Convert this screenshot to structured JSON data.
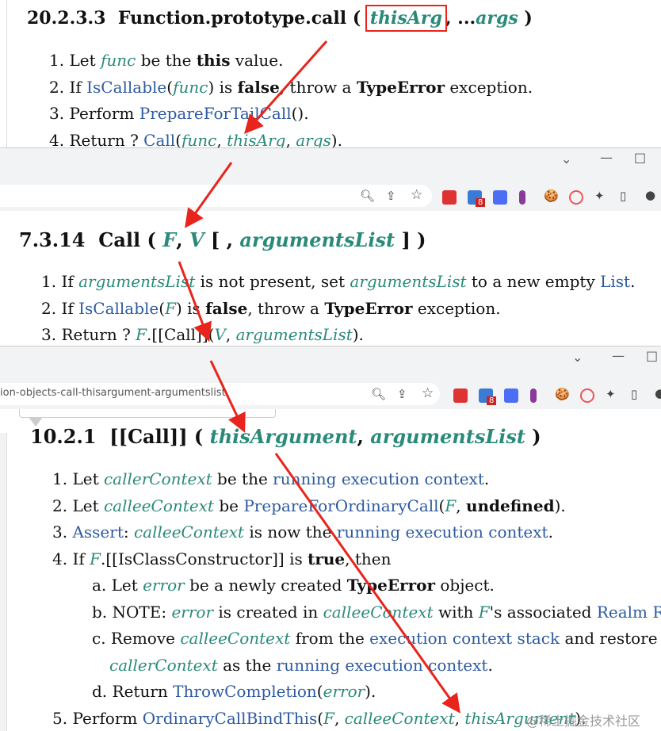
{
  "section1": {
    "number": "20.2.3.3",
    "title": "Function.prototype.call",
    "param1": "thisArg",
    "param2": "args",
    "steps": [
      {
        "n": "1.",
        "parts": [
          [
            "t",
            "Let "
          ],
          [
            "v",
            "func"
          ],
          [
            "t",
            " be the "
          ],
          [
            "b",
            "this"
          ],
          [
            "t",
            " value."
          ]
        ]
      },
      {
        "n": "2.",
        "parts": [
          [
            "t",
            "If "
          ],
          [
            "l",
            "IsCallable"
          ],
          [
            "t",
            "("
          ],
          [
            "v",
            "func"
          ],
          [
            "t",
            ") is "
          ],
          [
            "b",
            "false"
          ],
          [
            "t",
            ", throw a "
          ],
          [
            "b",
            "TypeError"
          ],
          [
            "t",
            " exception."
          ]
        ]
      },
      {
        "n": "3.",
        "parts": [
          [
            "t",
            "Perform "
          ],
          [
            "l",
            "PrepareForTailCall"
          ],
          [
            "t",
            "()."
          ]
        ]
      },
      {
        "n": "4.",
        "parts": [
          [
            "t",
            "Return ? "
          ],
          [
            "l",
            "Call"
          ],
          [
            "t",
            "("
          ],
          [
            "v",
            "func"
          ],
          [
            "t",
            ", "
          ],
          [
            "v",
            "thisArg"
          ],
          [
            "t",
            ", "
          ],
          [
            "v",
            "args"
          ],
          [
            "t",
            ")."
          ]
        ]
      }
    ]
  },
  "section2": {
    "number": "7.3.14",
    "title": "Call",
    "params": [
      "F",
      "V",
      "argumentsList"
    ],
    "steps": [
      {
        "n": "1.",
        "parts": [
          [
            "t",
            "If "
          ],
          [
            "v",
            "argumentsList"
          ],
          [
            "t",
            " is not present, set "
          ],
          [
            "v",
            "argumentsList"
          ],
          [
            "t",
            " to a new empty "
          ],
          [
            "l",
            "List"
          ],
          [
            "t",
            "."
          ]
        ]
      },
      {
        "n": "2.",
        "parts": [
          [
            "t",
            "If "
          ],
          [
            "l",
            "IsCallable"
          ],
          [
            "t",
            "("
          ],
          [
            "v",
            "F"
          ],
          [
            "t",
            ") is "
          ],
          [
            "b",
            "false"
          ],
          [
            "t",
            ", throw a "
          ],
          [
            "b",
            "TypeError"
          ],
          [
            "t",
            " exception."
          ]
        ]
      },
      {
        "n": "3.",
        "parts": [
          [
            "t",
            "Return ? "
          ],
          [
            "v",
            "F"
          ],
          [
            "t",
            ".[[Call]]("
          ],
          [
            "v",
            "V"
          ],
          [
            "t",
            ", "
          ],
          [
            "v",
            "argumentsList"
          ],
          [
            "t",
            ")."
          ]
        ]
      }
    ]
  },
  "section3": {
    "number": "10.2.1",
    "title": "[[Call]]",
    "params": [
      "thisArgument",
      "argumentsList"
    ],
    "steps": [
      {
        "n": "1.",
        "indent": 0,
        "parts": [
          [
            "t",
            "Let "
          ],
          [
            "v",
            "callerContext"
          ],
          [
            "t",
            " be the "
          ],
          [
            "l",
            "running execution context"
          ],
          [
            "t",
            "."
          ]
        ]
      },
      {
        "n": "2.",
        "indent": 0,
        "parts": [
          [
            "t",
            "Let "
          ],
          [
            "v",
            "calleeContext"
          ],
          [
            "t",
            " be "
          ],
          [
            "l",
            "PrepareForOrdinaryCall"
          ],
          [
            "t",
            "("
          ],
          [
            "v",
            "F"
          ],
          [
            "t",
            ", "
          ],
          [
            "b",
            "undefined"
          ],
          [
            "t",
            ")."
          ]
        ]
      },
      {
        "n": "3.",
        "indent": 0,
        "parts": [
          [
            "l",
            "Assert"
          ],
          [
            "t",
            ": "
          ],
          [
            "v",
            "calleeContext"
          ],
          [
            "t",
            " is now the "
          ],
          [
            "l",
            "running execution context"
          ],
          [
            "t",
            "."
          ]
        ]
      },
      {
        "n": "4.",
        "indent": 0,
        "parts": [
          [
            "t",
            "If "
          ],
          [
            "v",
            "F"
          ],
          [
            "t",
            ".[[IsClassConstructor]] is "
          ],
          [
            "b",
            "true"
          ],
          [
            "t",
            ", then"
          ]
        ]
      },
      {
        "n": "a.",
        "indent": 1,
        "parts": [
          [
            "t",
            "Let "
          ],
          [
            "v",
            "error"
          ],
          [
            "t",
            " be a newly created "
          ],
          [
            "b",
            "TypeError"
          ],
          [
            "t",
            " object."
          ]
        ]
      },
      {
        "n": "b.",
        "indent": 1,
        "parts": [
          [
            "t",
            "NOTE: "
          ],
          [
            "v",
            "error"
          ],
          [
            "t",
            " is created in "
          ],
          [
            "v",
            "calleeContext"
          ],
          [
            "t",
            " with "
          ],
          [
            "v",
            "F"
          ],
          [
            "t",
            "'s associated "
          ],
          [
            "l",
            "Realm Record"
          ],
          [
            "t",
            "."
          ]
        ]
      },
      {
        "n": "c.",
        "indent": 1,
        "parts": [
          [
            "t",
            "Remove "
          ],
          [
            "v",
            "calleeContext"
          ],
          [
            "t",
            " from the "
          ],
          [
            "l",
            "execution context stack"
          ],
          [
            "t",
            " and restore"
          ]
        ]
      },
      {
        "n": "",
        "indent": 2,
        "parts": [
          [
            "v",
            "callerContext"
          ],
          [
            "t",
            " as the "
          ],
          [
            "l",
            "running execution context"
          ],
          [
            "t",
            "."
          ]
        ]
      },
      {
        "n": "d.",
        "indent": 1,
        "parts": [
          [
            "t",
            "Return "
          ],
          [
            "l",
            "ThrowCompletion"
          ],
          [
            "t",
            "("
          ],
          [
            "v",
            "error"
          ],
          [
            "t",
            ")."
          ]
        ]
      },
      {
        "n": "5.",
        "indent": 0,
        "parts": [
          [
            "t",
            "Perform "
          ],
          [
            "l",
            "OrdinaryCallBindThis"
          ],
          [
            "t",
            "("
          ],
          [
            "v",
            "F"
          ],
          [
            "t",
            ", "
          ],
          [
            "v",
            "calleeContext"
          ],
          [
            "t",
            ", "
          ],
          [
            "v",
            "thisArgument"
          ],
          [
            "t",
            ")."
          ]
        ]
      }
    ]
  },
  "browser2": {
    "url_fragment": "ion-objects-call-thisargument-argumentslist",
    "badge": "8"
  },
  "browser1": {
    "badge": "8"
  },
  "watermark": "@稀土掘金技术社区",
  "colors": {
    "arrow": "#e8241c",
    "var": "#2a8a7a",
    "link": "#2d5aa0"
  }
}
